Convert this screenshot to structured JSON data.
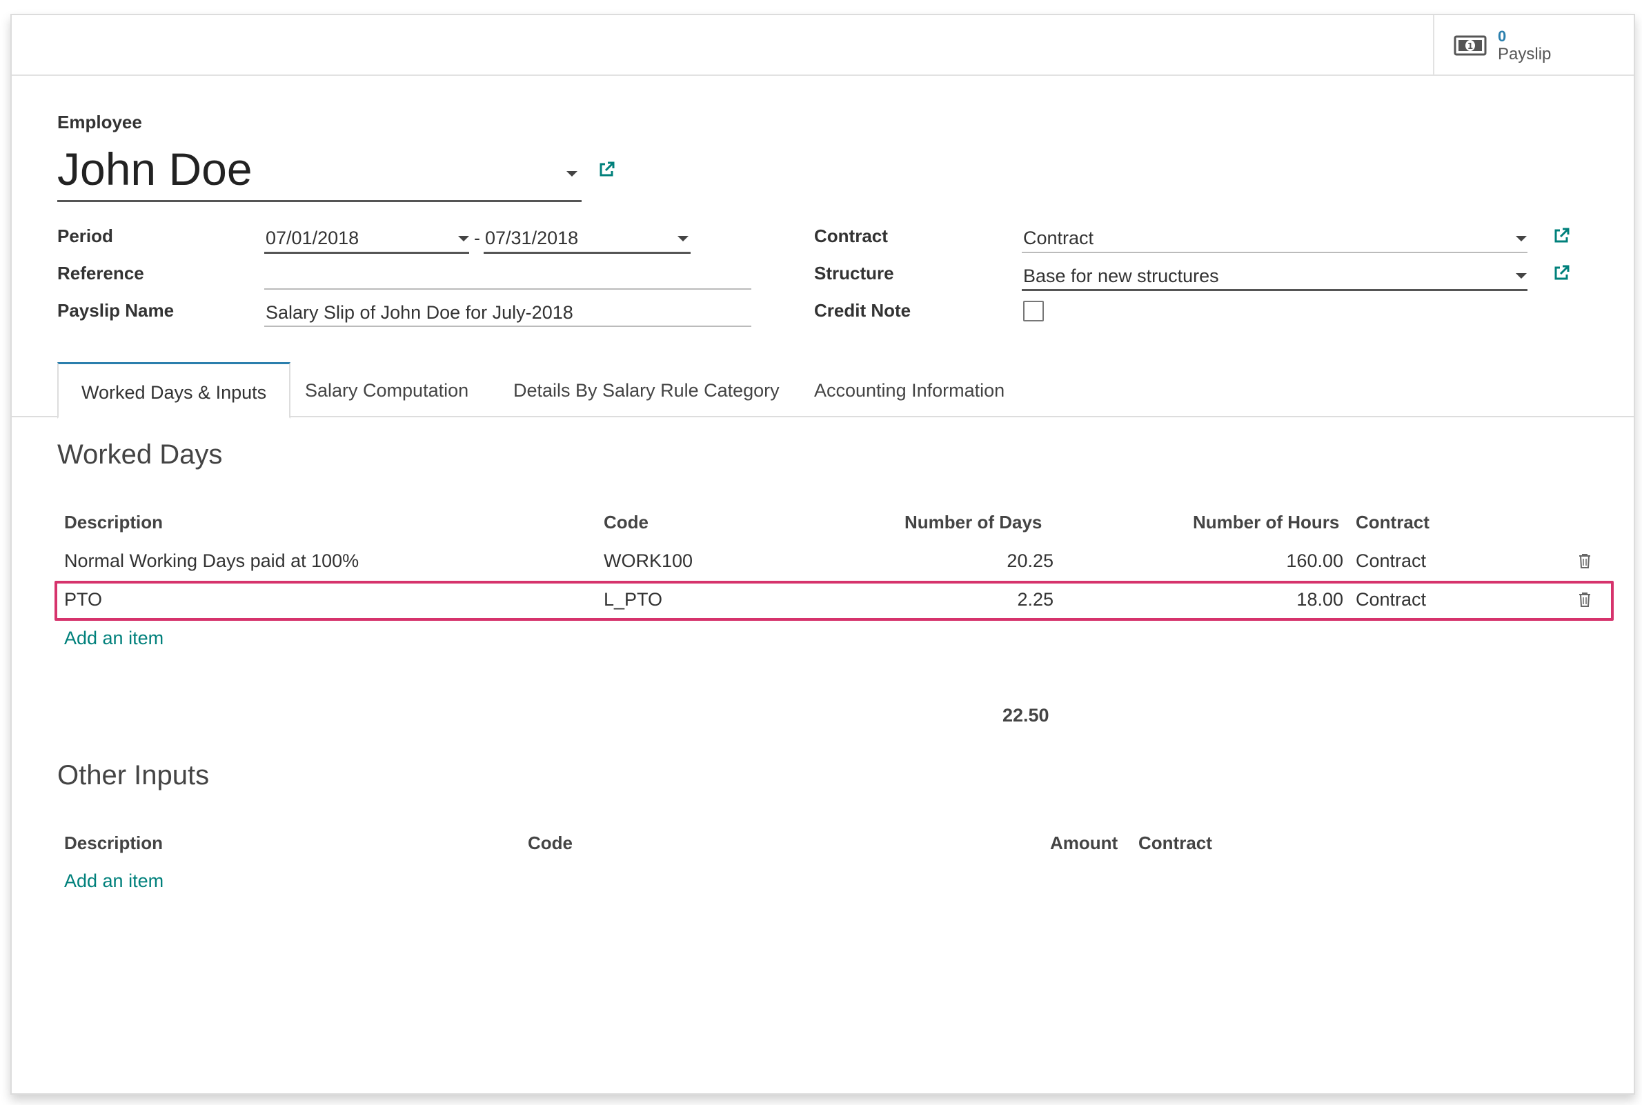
{
  "smart_button": {
    "value": "0",
    "label": "Payslip",
    "icon": "money-icon"
  },
  "employee": {
    "label": "Employee",
    "name": "John Doe"
  },
  "period": {
    "label": "Period",
    "start": "07/01/2018",
    "separator": "-",
    "end": "07/31/2018"
  },
  "reference": {
    "label": "Reference",
    "value": ""
  },
  "payslip_name": {
    "label": "Payslip Name",
    "value": "Salary Slip of John Doe for July-2018"
  },
  "contract": {
    "label": "Contract",
    "value": "Contract"
  },
  "structure": {
    "label": "Structure",
    "value": "Base for new structures"
  },
  "credit_note": {
    "label": "Credit Note",
    "checked": false
  },
  "tabs": [
    {
      "label": "Worked Days & Inputs",
      "active": true
    },
    {
      "label": "Salary Computation",
      "active": false
    },
    {
      "label": "Details By Salary Rule Category",
      "active": false
    },
    {
      "label": "Accounting Information",
      "active": false
    }
  ],
  "worked_days": {
    "title": "Worked Days",
    "columns": [
      "Description",
      "Code",
      "Number of Days",
      "Number of Hours",
      "Contract"
    ],
    "rows": [
      {
        "description": "Normal Working Days paid at 100%",
        "code": "WORK100",
        "days": "20.25",
        "hours": "160.00",
        "contract": "Contract",
        "highlighted": false
      },
      {
        "description": "PTO",
        "code": "L_PTO",
        "days": "2.25",
        "hours": "18.00",
        "contract": "Contract",
        "highlighted": true
      }
    ],
    "add_item": "Add an item",
    "total_days": "22.50"
  },
  "other_inputs": {
    "title": "Other Inputs",
    "columns": [
      "Description",
      "Code",
      "Amount",
      "Contract"
    ],
    "add_item": "Add an item"
  },
  "colors": {
    "accent": "#2b7fad",
    "link": "#00807b",
    "highlight": "#d6336c"
  }
}
